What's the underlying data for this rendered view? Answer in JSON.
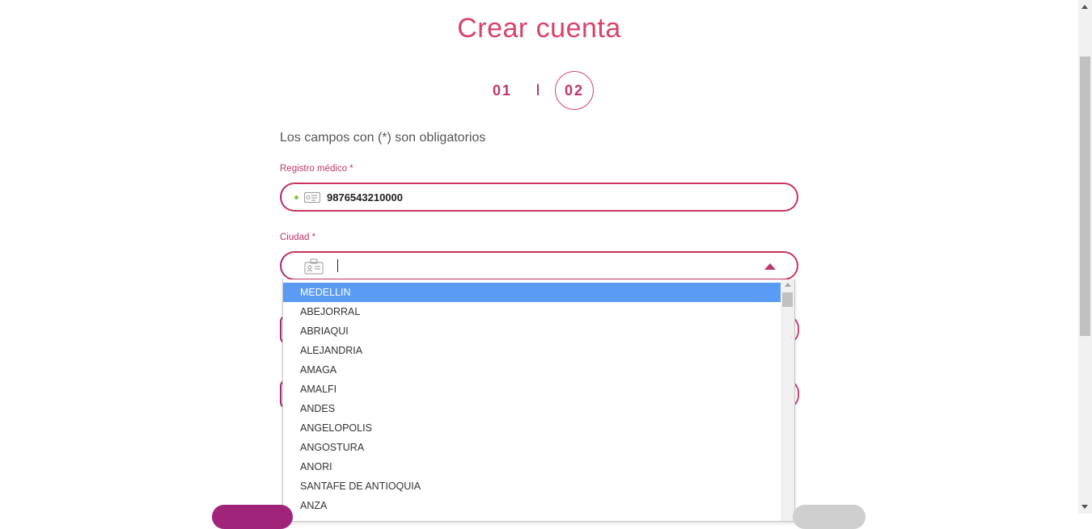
{
  "header": {
    "title": "Crear cuenta"
  },
  "steps": {
    "step1": "01",
    "step2": "02"
  },
  "form": {
    "required_note": "Los campos con (*) son obligatorios",
    "registro": {
      "label": "Registro médico *",
      "value": "9876543210000"
    },
    "ciudad": {
      "label": "Ciudad *",
      "value": ""
    }
  },
  "dropdown": {
    "options": [
      "MEDELLIN",
      "ABEJORRAL",
      "ABRIAQUI",
      "ALEJANDRIA",
      "AMAGA",
      "AMALFI",
      "ANDES",
      "ANGELOPOLIS",
      "ANGOSTURA",
      "ANORI",
      "SANTAFE DE ANTIOQUIA",
      "ANZA"
    ],
    "selected_index": 0
  },
  "icons": {
    "registro": "id-card-icon",
    "ciudad": "city-card-icon",
    "dropdown_toggle": "chevron-up-icon"
  },
  "colors": {
    "accent": "#d9426a",
    "brand": "#a0247a",
    "selected": "#5a9bf6"
  }
}
